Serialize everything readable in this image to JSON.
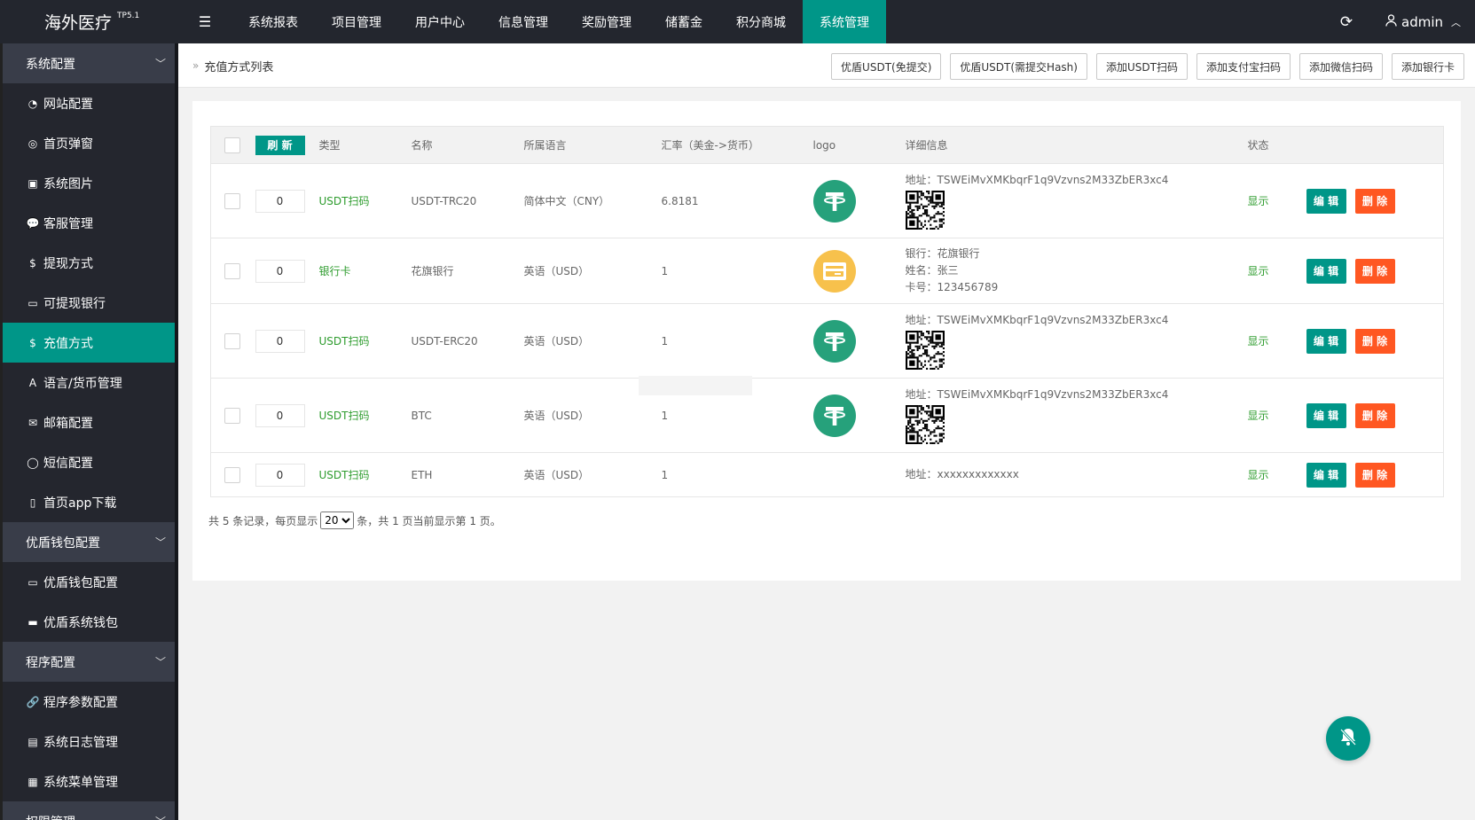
{
  "header": {
    "logo": "海外医疗",
    "logo_sup": "TP5.1",
    "nav": [
      {
        "label": "系统报表"
      },
      {
        "label": "项目管理"
      },
      {
        "label": "用户中心"
      },
      {
        "label": "信息管理"
      },
      {
        "label": "奖励管理"
      },
      {
        "label": "储蓄金"
      },
      {
        "label": "积分商城"
      },
      {
        "label": "系统管理",
        "active": true
      }
    ],
    "user": "admin"
  },
  "sidebar": {
    "groups": [
      {
        "label": "系统配置",
        "items": [
          {
            "label": "网站配置",
            "icon": "dashboard-icon"
          },
          {
            "label": "首页弹窗",
            "icon": "eye-icon"
          },
          {
            "label": "系统图片",
            "icon": "image-icon"
          },
          {
            "label": "客服管理",
            "icon": "chat-icon"
          },
          {
            "label": "提现方式",
            "icon": "dollar-icon"
          },
          {
            "label": "可提现银行",
            "icon": "card-icon"
          },
          {
            "label": "充值方式",
            "icon": "dollar-icon",
            "active": true
          },
          {
            "label": "语言/货币管理",
            "icon": "font-icon"
          },
          {
            "label": "邮箱配置",
            "icon": "mail-icon"
          },
          {
            "label": "短信配置",
            "icon": "message-icon"
          },
          {
            "label": "首页app下载",
            "icon": "mobile-icon"
          }
        ]
      },
      {
        "label": "优盾钱包配置",
        "items": [
          {
            "label": "优盾钱包配置",
            "icon": "card-icon"
          },
          {
            "label": "优盾系统钱包",
            "icon": "wallet-icon"
          }
        ]
      },
      {
        "label": "程序配置",
        "items": [
          {
            "label": "程序参数配置",
            "icon": "link-icon"
          },
          {
            "label": "系统日志管理",
            "icon": "file-icon"
          },
          {
            "label": "系统菜单管理",
            "icon": "table-icon"
          }
        ]
      },
      {
        "label": "权限管理",
        "items": []
      }
    ]
  },
  "page": {
    "breadcrumb": "充值方式列表",
    "actions": [
      "优盾USDT(免提交)",
      "优盾USDT(需提交Hash)",
      "添加USDT扫码",
      "添加支付宝扫码",
      "添加微信扫码",
      "添加银行卡"
    ]
  },
  "table": {
    "refresh_label": "刷 新",
    "headers": {
      "type": "类型",
      "name": "名称",
      "lang": "所属语言",
      "rate": "汇率（美金->货币）",
      "logo": "logo",
      "detail": "详细信息",
      "status": "状态"
    },
    "rows": [
      {
        "sort": "0",
        "type": "USDT扫码",
        "name": "USDT-TRC20",
        "lang": "简体中文（CNY）",
        "rate": "6.8181",
        "logo": "usdt-logo-icon",
        "detail": [
          "地址：TSWEiMvXMKbqrF1q9Vzvns2M33ZbER3xc4"
        ],
        "qr": true,
        "status": "显示",
        "edit": "编 辑",
        "del": "删 除"
      },
      {
        "sort": "0",
        "type": "银行卡",
        "name": "花旗银行",
        "lang": "英语（USD）",
        "rate": "1",
        "logo": "bank-card-logo-icon",
        "detail": [
          "银行：花旗银行",
          "姓名：张三",
          "卡号：123456789"
        ],
        "qr": false,
        "status": "显示",
        "edit": "编 辑",
        "del": "删 除"
      },
      {
        "sort": "0",
        "type": "USDT扫码",
        "name": "USDT-ERC20",
        "lang": "英语（USD）",
        "rate": "1",
        "logo": "usdt-logo-icon",
        "detail": [
          "地址：TSWEiMvXMKbqrF1q9Vzvns2M33ZbER3xc4"
        ],
        "qr": true,
        "status": "显示",
        "edit": "编 辑",
        "del": "删 除"
      },
      {
        "sort": "0",
        "type": "USDT扫码",
        "name": "BTC",
        "lang": "英语（USD）",
        "rate": "1",
        "logo": "usdt-logo-icon",
        "detail": [
          "地址：TSWEiMvXMKbqrF1q9Vzvns2M33ZbER3xc4"
        ],
        "qr": true,
        "status": "显示",
        "edit": "编 辑",
        "del": "删 除"
      },
      {
        "sort": "0",
        "type": "USDT扫码",
        "name": "ETH",
        "lang": "英语（USD）",
        "rate": "1",
        "logo": "",
        "detail": [
          "地址：xxxxxxxxxxxxx"
        ],
        "qr": false,
        "status": "显示",
        "edit": "编 辑",
        "del": "删 除"
      }
    ]
  },
  "pager": {
    "prefix": "共 5 条记录，每页显示",
    "per_page": "20",
    "suffix": "条，共 1 页当前显示第 1 页。"
  },
  "colors": {
    "accent": "#009688",
    "danger": "#ff5722",
    "header_bg": "#23262e",
    "sidebar_bg": "#2b2e37",
    "status_green": "#2e9c2e"
  }
}
